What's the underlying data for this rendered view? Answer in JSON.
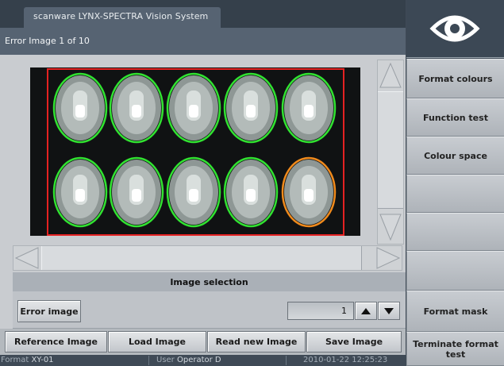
{
  "window": {
    "title": "scanware LYNX-SPECTRA Vision System",
    "subtitle": "Error Image 1 of 10"
  },
  "logo": {
    "icon": "eye-icon"
  },
  "sidebar": {
    "items": [
      {
        "label": "Format colours"
      },
      {
        "label": "Function test"
      },
      {
        "label": "Colour space"
      },
      {
        "label": ""
      },
      {
        "label": ""
      },
      {
        "label": ""
      },
      {
        "label": "Format mask"
      },
      {
        "label": "Terminate format test"
      }
    ]
  },
  "inspection": {
    "rows": [
      [
        "ok",
        "ok",
        "ok",
        "ok",
        "ok"
      ],
      [
        "ok",
        "ok",
        "ok",
        "ok",
        "warning"
      ]
    ],
    "colors": {
      "ok": "#31e231",
      "warning": "#f08a1c",
      "frame": "#e42222"
    }
  },
  "selection": {
    "header": "Image selection",
    "error_image_label": "Error image",
    "page_value": "1"
  },
  "bottom_buttons": {
    "reference": "Reference Image",
    "load": "Load Image",
    "read_new": "Read new Image",
    "save": "Save Image"
  },
  "status": {
    "format_label": "Format",
    "format_value": "XY-01",
    "user_label": "User",
    "user_value": "Operator D",
    "datetime": "2010-01-22 12:25:23"
  }
}
